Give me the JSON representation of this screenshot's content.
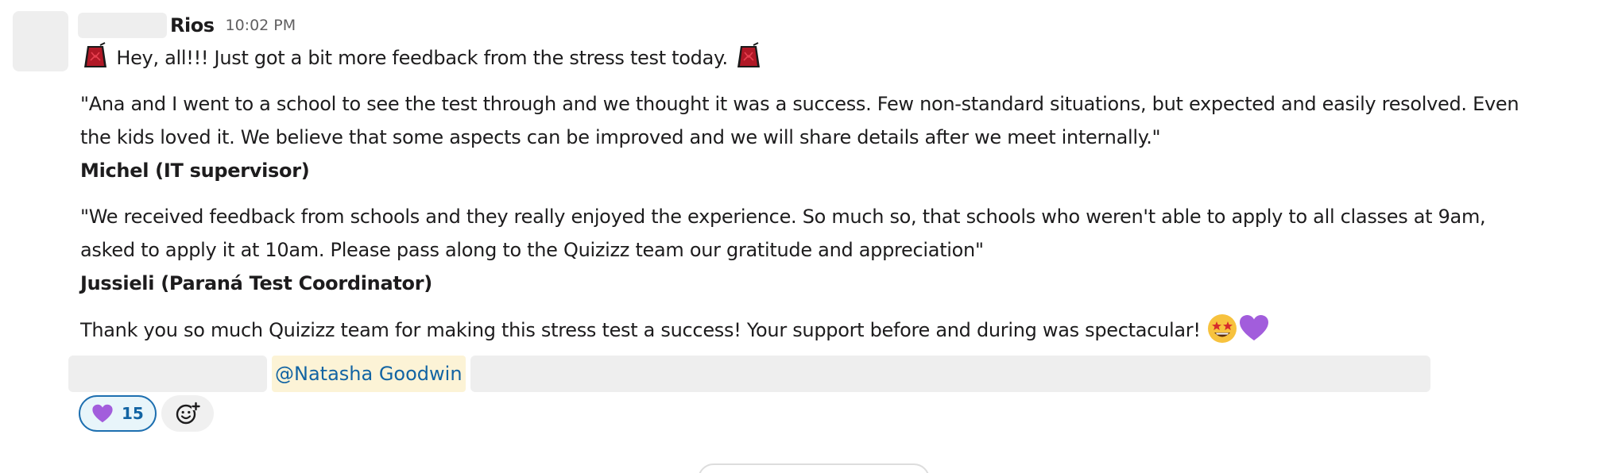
{
  "message": {
    "author": "Rios",
    "timestamp": "10:02 PM",
    "line1": "Hey, all!!! Just got a bit more feedback from the stress test today.",
    "quote1_line1": "\"Ana and I went to a school to see the test through and we thought it was a success. Few non-standard situations, but expected and easily resolved. Even",
    "quote1_line2": "the kids loved it. We believe that some aspects can be improved and we will share details after we meet internally.\"",
    "quote1_author": "Michel (IT supervisor)",
    "quote2_line1": "\"We received feedback from schools and they really enjoyed the experience. So much so, that schools who weren't able to apply to all classes at 9am,",
    "quote2_line2": "asked to apply it at 10am. Please pass along to the Quizizz team our gratitude and appreciation\"",
    "quote2_author": "Jussieli (Paraná Test Coordinator)",
    "thanks": "Thank you so much Quizizz team for making this stress test a success! Your support before and during was spectacular!",
    "mention": "@Natasha Goodwin"
  },
  "icons": {
    "emoji_left": "fez-hat-icon",
    "emoji_right": "fez-hat-icon",
    "emoji_star_struck": "star-struck-icon",
    "emoji_heart": "purple-heart-icon",
    "reaction_emoji": "purple-heart-icon",
    "add_reaction": "add-reaction-icon"
  },
  "reactions": [
    {
      "emoji": "purple-heart",
      "count": "15"
    }
  ],
  "colors": {
    "mention_bg": "#fcf3d6",
    "mention_text": "#1264a3",
    "reaction_border": "#1d6fb0",
    "reaction_bg": "#e8f5fa",
    "heart": "#a25ddc"
  }
}
